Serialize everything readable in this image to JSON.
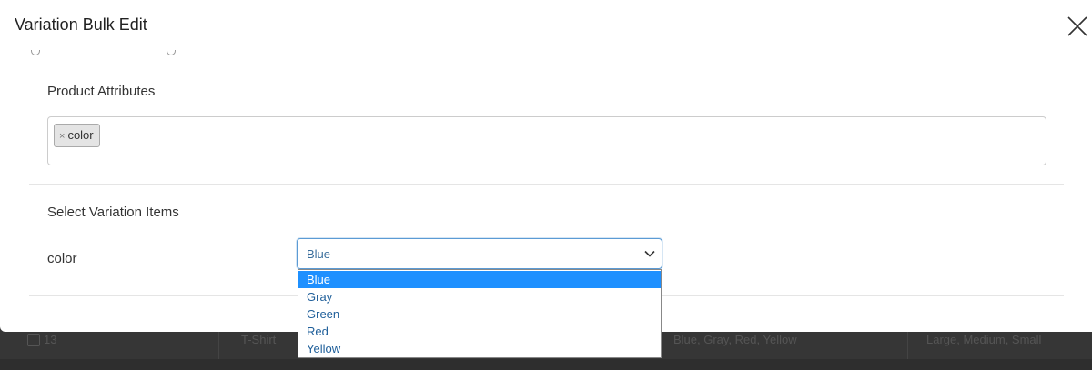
{
  "modal": {
    "title": "Variation Bulk Edit",
    "product_attributes_label": "Product Attributes",
    "select_variation_label": "Select Variation Items"
  },
  "tags": [
    {
      "remove": "×",
      "label": "color"
    }
  ],
  "variation": {
    "attribute_name": "color",
    "selected": "Blue",
    "options": [
      "Blue",
      "Gray",
      "Green",
      "Red",
      "Yellow"
    ]
  },
  "background_row": {
    "id": "13",
    "name": "T-Shirt",
    "colors": "Blue, Gray, Red, Yellow",
    "sizes": "Large, Medium, Small"
  },
  "colors": {
    "accent": "#1e90ff",
    "focus_border": "#5b9bd5"
  }
}
